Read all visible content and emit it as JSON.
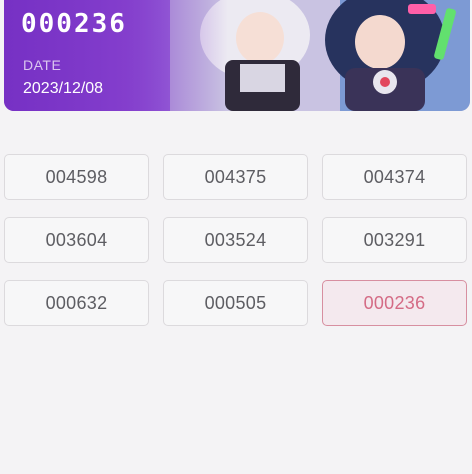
{
  "banner": {
    "number": "000236",
    "date_label": "DATE",
    "date_value": "2023/12/08",
    "accent_color": "#7b35c7"
  },
  "grid": {
    "selected_color": "#d46b85",
    "items": [
      {
        "label": "004598",
        "selected": false
      },
      {
        "label": "004375",
        "selected": false
      },
      {
        "label": "004374",
        "selected": false
      },
      {
        "label": "003604",
        "selected": false
      },
      {
        "label": "003524",
        "selected": false
      },
      {
        "label": "003291",
        "selected": false
      },
      {
        "label": "000632",
        "selected": false
      },
      {
        "label": "000505",
        "selected": false
      },
      {
        "label": "000236",
        "selected": true
      }
    ]
  }
}
